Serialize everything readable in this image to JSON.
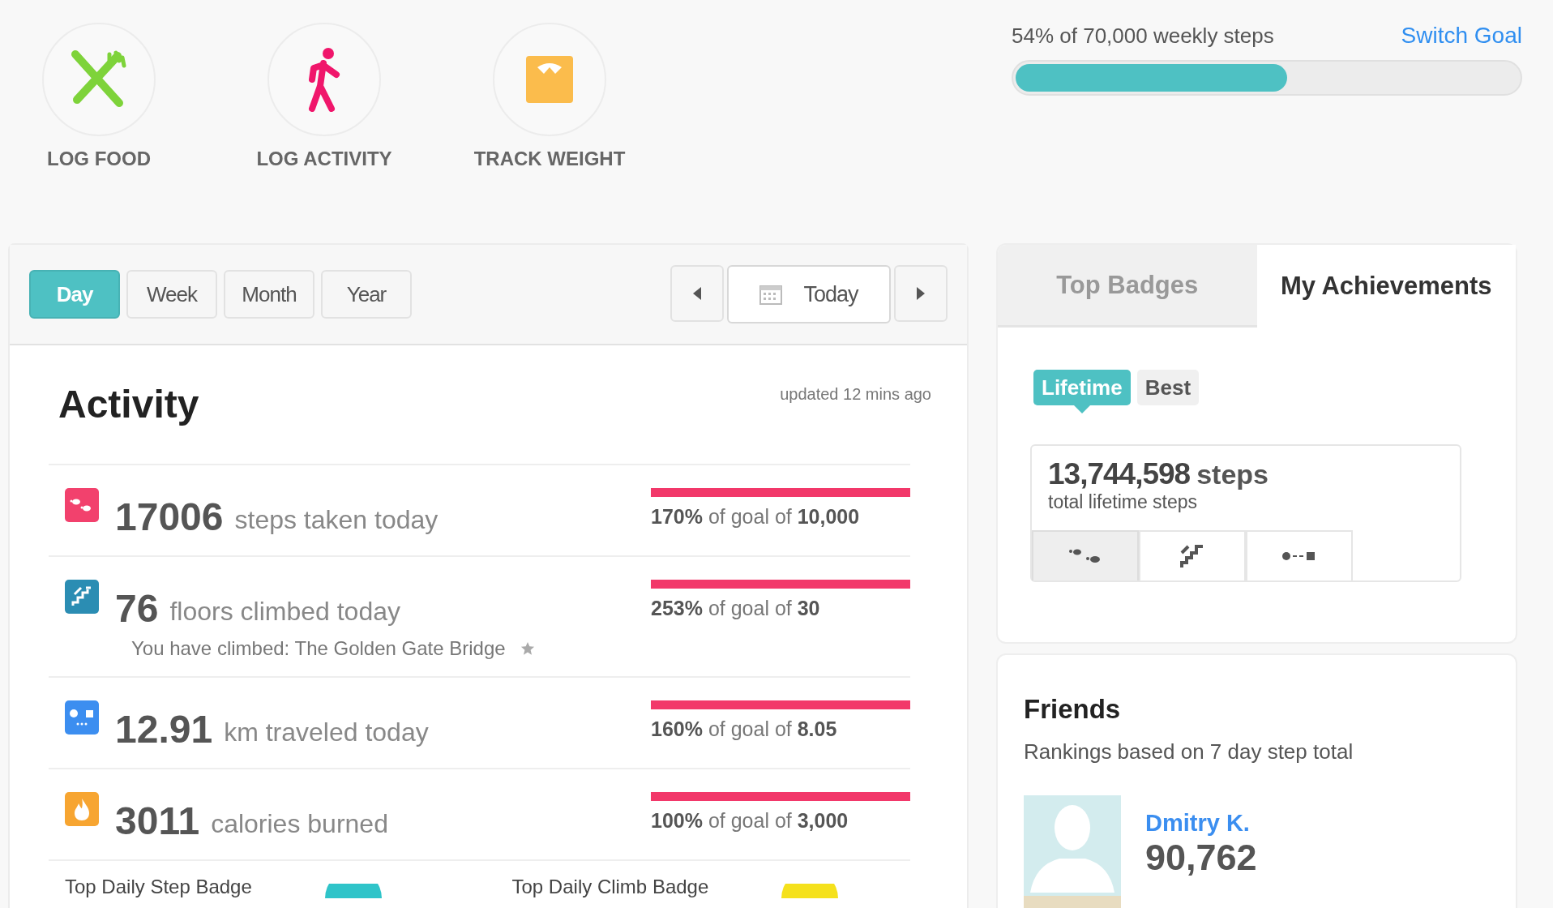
{
  "quick_actions": [
    {
      "kind": "food",
      "label": "LOG FOOD"
    },
    {
      "kind": "activity",
      "label": "LOG ACTIVITY"
    },
    {
      "kind": "weight",
      "label": "TRACK WEIGHT"
    }
  ],
  "weekly_goal": {
    "text": "54% of 70,000 weekly steps",
    "link": "Switch Goal",
    "level": 0.54
  },
  "range_tabs": [
    {
      "label": "Day",
      "selected": true
    },
    {
      "label": "Week",
      "selected": false
    },
    {
      "label": "Month",
      "selected": false
    },
    {
      "label": "Year",
      "selected": false
    }
  ],
  "date_nav": {
    "label": "Today"
  },
  "activity": {
    "title": "Activity",
    "updated": "updated 12 mins ago",
    "rows": [
      {
        "kind": "steps",
        "color": "#f2416d",
        "value": "17006",
        "label": "steps taken today",
        "goal": "**170%** of goal of **10,000**",
        "level": 1
      },
      {
        "kind": "floors",
        "color": "#2b8db3",
        "value": "76",
        "label": "floors climbed today",
        "goal": "**253%** of goal of **30**",
        "level": 1,
        "note": "You have climbed: The Golden Gate Bridge"
      },
      {
        "kind": "distance",
        "color": "#3c8ef0",
        "value": "12.91",
        "label": "km traveled today",
        "goal": "**160%** of goal of **8.05**",
        "level": 1
      },
      {
        "kind": "calories",
        "color": "#f7a531",
        "value": "3011",
        "label": "calories burned",
        "goal": "**100%** of goal of **3,000**",
        "level": 1
      }
    ],
    "badges": [
      {
        "label": "Top Daily Step Badge",
        "color": "#2fc4c9"
      },
      {
        "label": "Top Daily Climb Badge",
        "color": "#f5e11c"
      }
    ]
  },
  "achievements": {
    "tabs": [
      {
        "label": "Top Badges",
        "selected": false
      },
      {
        "label": "My Achievements",
        "selected": true
      }
    ],
    "periods": [
      {
        "label": "Lifetime",
        "selected": true
      },
      {
        "label": "Best",
        "selected": false
      }
    ],
    "stat": {
      "value": "13,744,598",
      "unit": "steps",
      "caption": "total lifetime steps"
    },
    "metric_tabs": [
      {
        "kind": "steps",
        "selected": true
      },
      {
        "kind": "floors",
        "selected": false
      },
      {
        "kind": "distance",
        "selected": false
      }
    ]
  },
  "friends": {
    "title": "Friends",
    "subtitle": "Rankings based on 7 day step total",
    "entries": [
      {
        "name": "Dmitry K.",
        "steps": "90,762"
      }
    ]
  }
}
